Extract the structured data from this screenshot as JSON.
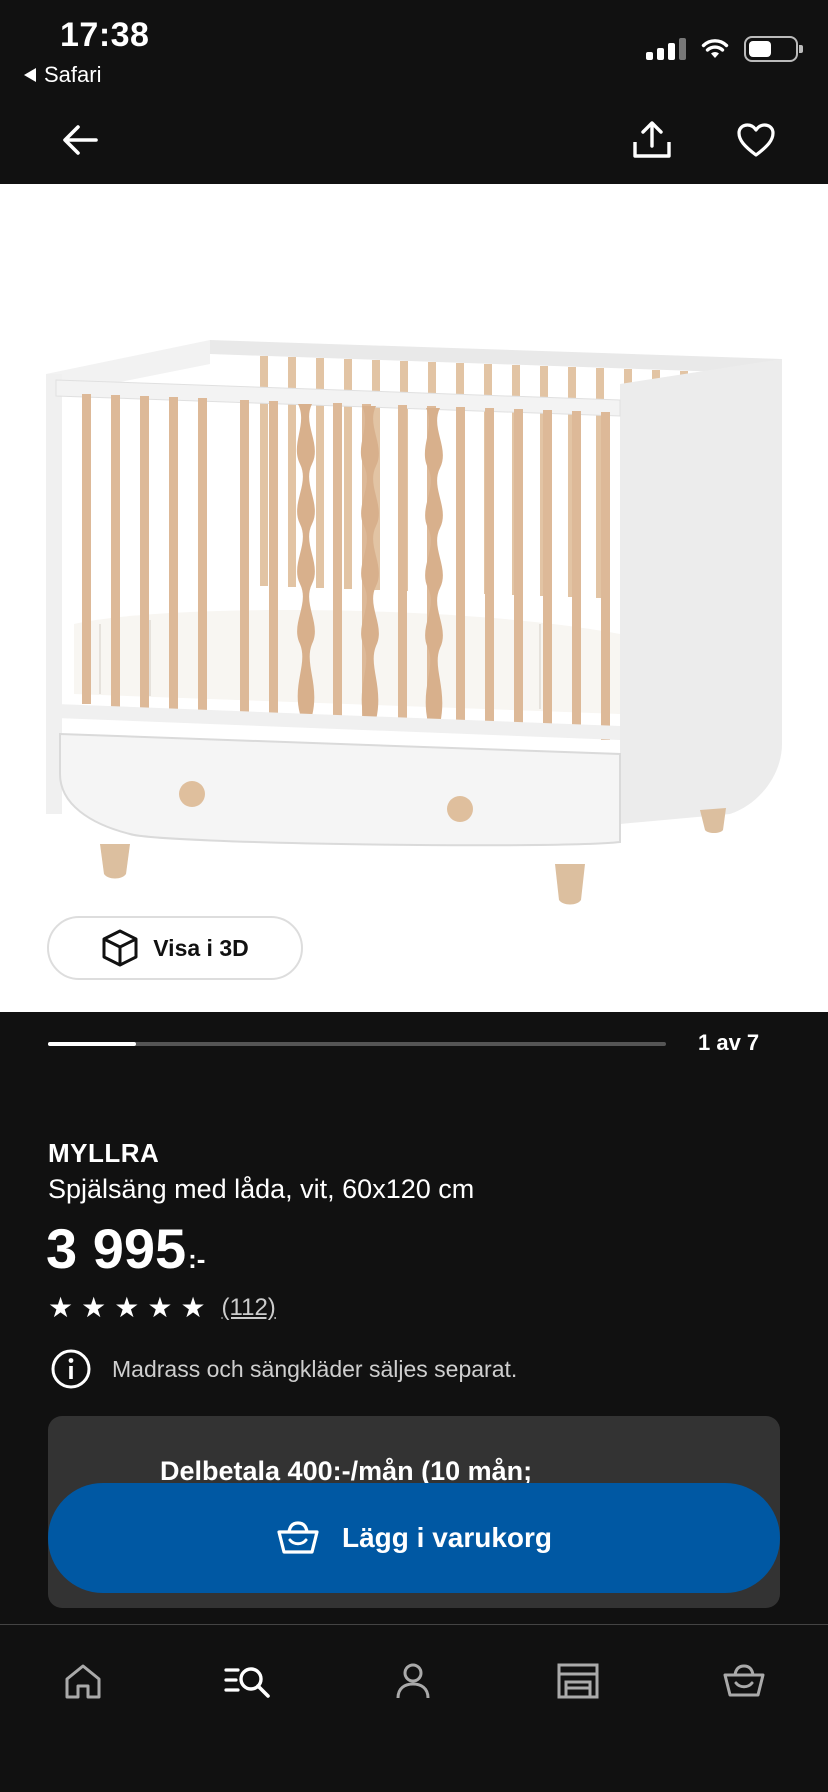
{
  "status_bar": {
    "time": "17:38",
    "back_app": "Safari"
  },
  "header": {
    "back_icon": "arrow-left-icon",
    "share_icon": "share-icon",
    "favorite_icon": "heart-icon"
  },
  "gallery": {
    "view_3d_label": "Visa i 3D",
    "current": 1,
    "total": 7,
    "counter_text": "1 av 7"
  },
  "product": {
    "brand": "MYLLRA",
    "description": "Spjälsäng med låda, vit, 60x120 cm",
    "price": "3 995",
    "price_suffix": ":-",
    "rating_stars": 5,
    "review_count": "(112)",
    "notice": "Madrass och sängkläder säljes separat."
  },
  "installment": {
    "text": "Delbetala 400:-/mån (10 mån;"
  },
  "cta": {
    "label": "Lägg i varukorg",
    "color": "#0058a3"
  },
  "tabbar": {
    "items": [
      {
        "icon": "home-icon"
      },
      {
        "icon": "search-list-icon"
      },
      {
        "icon": "profile-icon"
      },
      {
        "icon": "store-icon"
      },
      {
        "icon": "basket-icon"
      }
    ]
  }
}
